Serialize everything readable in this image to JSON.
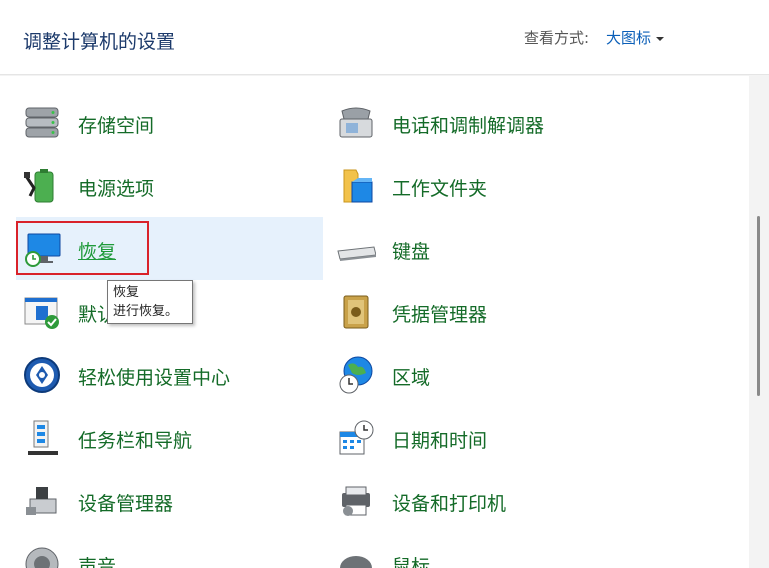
{
  "header": {
    "title": "调整计算机的设置",
    "view_label": "查看方式:",
    "view_value": "大图标"
  },
  "items_left": [
    {
      "label": "存储空间",
      "icon": "storage-icon"
    },
    {
      "label": "电源选项",
      "icon": "power-icon"
    },
    {
      "label": "恢复",
      "icon": "recovery-icon"
    },
    {
      "label": "默认",
      "icon": "default-programs-icon"
    },
    {
      "label": "轻松使用设置中心",
      "icon": "ease-of-access-icon"
    },
    {
      "label": "任务栏和导航",
      "icon": "taskbar-icon"
    },
    {
      "label": "设备管理器",
      "icon": "device-manager-icon"
    },
    {
      "label": "声音",
      "icon": "sound-icon"
    }
  ],
  "items_right": [
    {
      "label": "电话和调制解调器",
      "icon": "phone-modem-icon"
    },
    {
      "label": "工作文件夹",
      "icon": "work-folders-icon"
    },
    {
      "label": "键盘",
      "icon": "keyboard-icon"
    },
    {
      "label": "凭据管理器",
      "icon": "credential-manager-icon"
    },
    {
      "label": "区域",
      "icon": "region-icon"
    },
    {
      "label": "日期和时间",
      "icon": "date-time-icon"
    },
    {
      "label": "设备和打印机",
      "icon": "devices-printers-icon"
    },
    {
      "label": "鼠标",
      "icon": "mouse-icon"
    }
  ],
  "tooltip": {
    "title": "恢复",
    "desc": "进行恢复。"
  },
  "colors": {
    "link_green": "#146b28",
    "hover_bg": "#e6f1fc",
    "highlight_red": "#d9222a",
    "header_title": "#1c3a6b",
    "view_link": "#0b5fb8"
  }
}
